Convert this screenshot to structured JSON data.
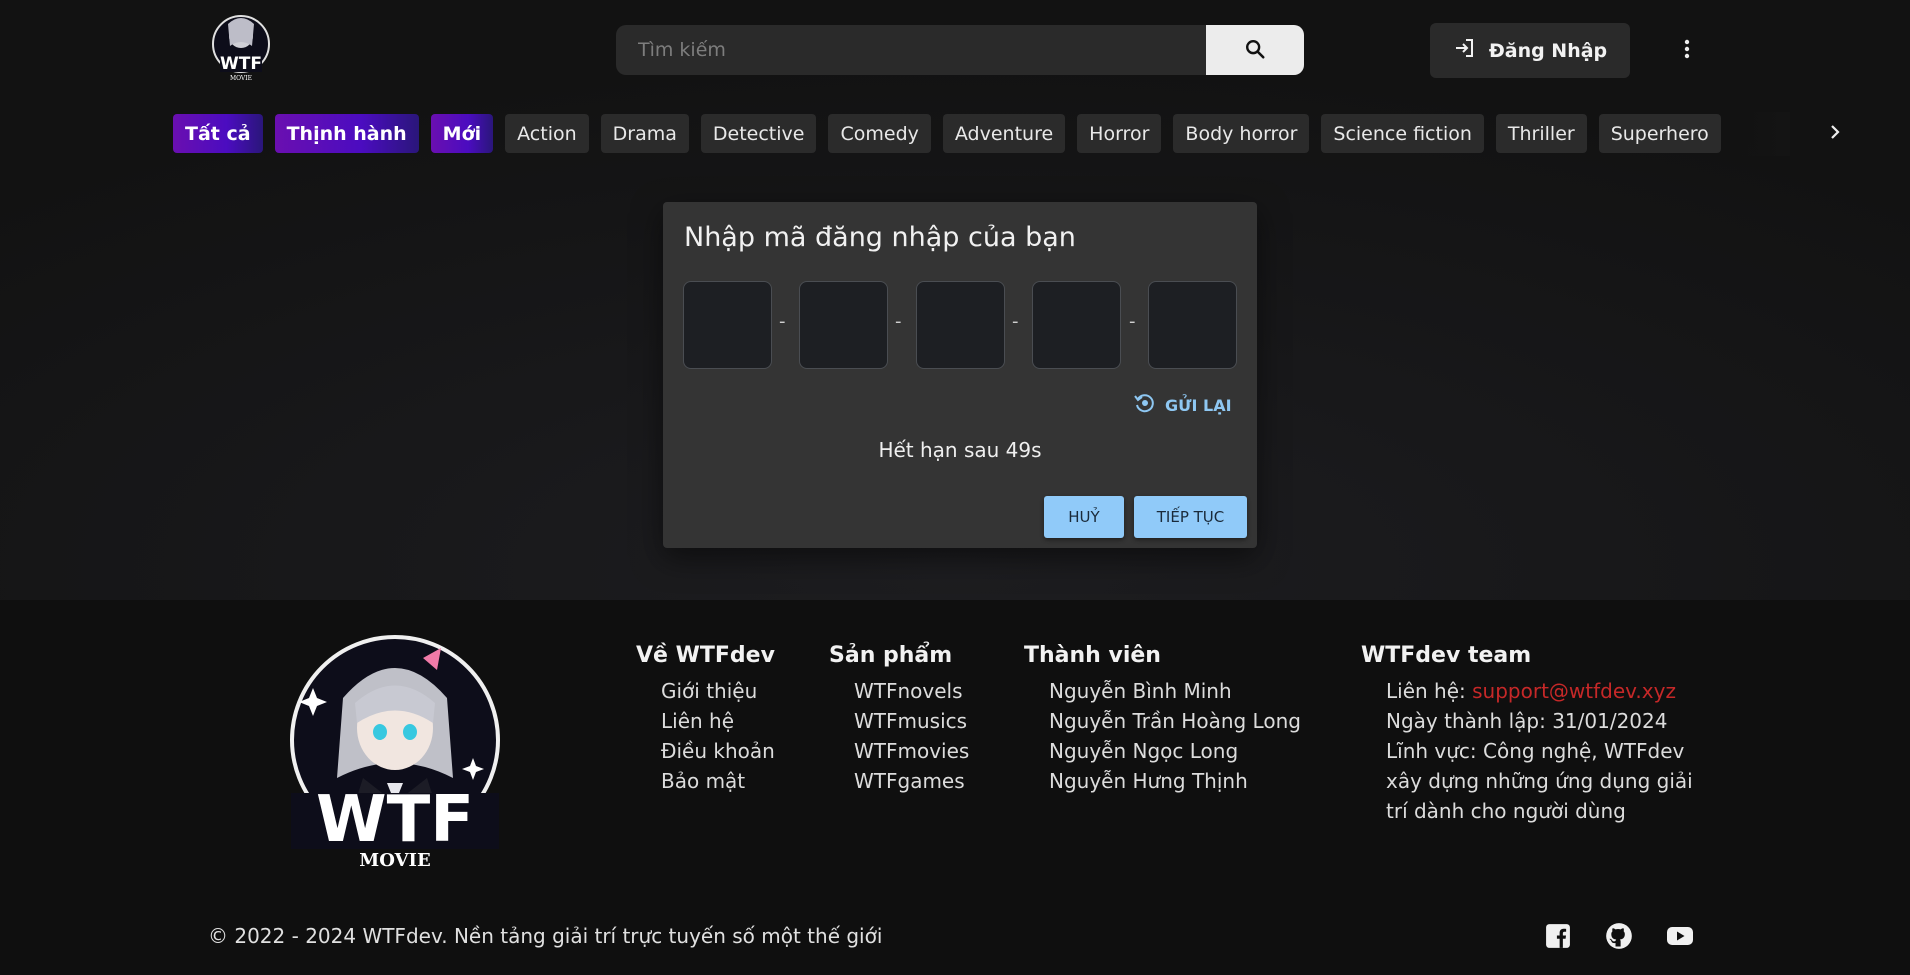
{
  "header": {
    "logo_text": "WTF",
    "logo_sub": "MOVIE",
    "search_placeholder": "Tìm kiếm",
    "login_label": "Đăng Nhập"
  },
  "genres": [
    "Tất cả",
    "Thịnh hành",
    "Mới",
    "Action",
    "Drama",
    "Detective",
    "Comedy",
    "Adventure",
    "Horror",
    "Body horror",
    "Science fiction",
    "Thriller",
    "Superhero"
  ],
  "dialog": {
    "title": "Nhập mã đăng nhập của bạn",
    "separator": "-",
    "resend_label": "GỬI LẠI",
    "expire_text": "Hết hạn sau 49s",
    "cancel_label": "HUỶ",
    "continue_label": "TIẾP TỤC"
  },
  "footer": {
    "col1": {
      "title": "Về WTFdev",
      "items": [
        "Giới thiệu",
        "Liên hệ",
        "Điều khoản",
        "Bảo mật"
      ]
    },
    "col2": {
      "title": "Sản phẩm",
      "items": [
        "WTFnovels",
        "WTFmusics",
        "WTFmovies",
        "WTFgames"
      ]
    },
    "col3": {
      "title": "Thành viên",
      "items": [
        "Nguyễn Bình Minh",
        "Nguyễn Trần Hoàng Long",
        "Nguyễn Ngọc Long",
        "Nguyễn Hưng Thịnh"
      ]
    },
    "col4": {
      "title": "WTFdev team",
      "contact_label": "Liên hệ: ",
      "contact_email": "support@wtfdev.xyz",
      "founded": "Ngày thành lập: 31/01/2024",
      "field_line1": "Lĩnh vực: Công nghệ, WTFdev",
      "field_line2": "xây dựng những ứng dụng giải",
      "field_line3": "trí dành cho người dùng"
    },
    "copyright": "© 2022 - 2024 WTFdev. Nền tảng giải trí trực tuyến số một thế giới"
  },
  "icons": {
    "search": "search-icon",
    "login": "login-icon",
    "more": "more-vertical-icon",
    "resend": "refresh-icon",
    "facebook": "facebook-icon",
    "github": "github-icon",
    "youtube": "youtube-icon"
  },
  "colors": {
    "accent": "#90caf9",
    "chip_highlight": "#5a0fb8",
    "link_red": "#c62828"
  }
}
